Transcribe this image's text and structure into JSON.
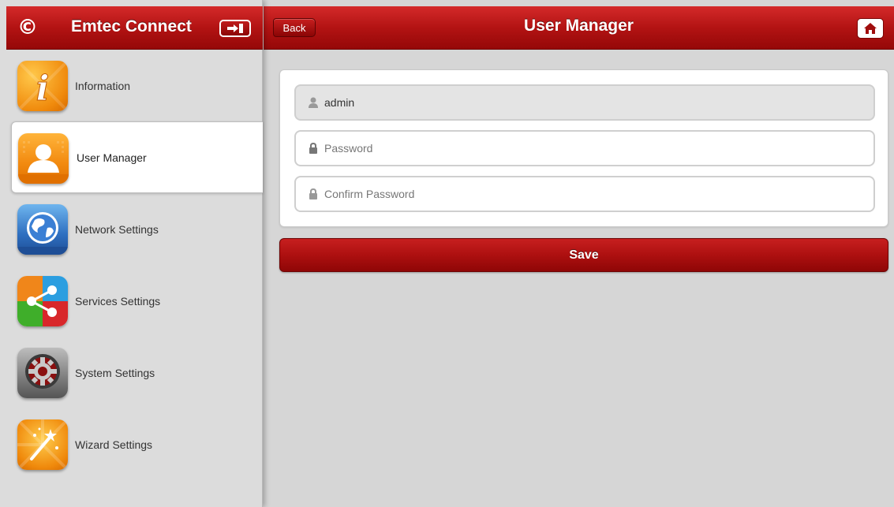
{
  "app": {
    "title": "Emtec Connect",
    "accent_color": "#b31313"
  },
  "header": {
    "back_label": "Back",
    "page_title": "User Manager"
  },
  "sidebar": {
    "items": [
      {
        "label": "Information",
        "icon": "information-icon",
        "active": false
      },
      {
        "label": "User Manager",
        "icon": "user-icon",
        "active": true
      },
      {
        "label": "Network Settings",
        "icon": "globe-icon",
        "active": false
      },
      {
        "label": "Services Settings",
        "icon": "share-icon",
        "active": false
      },
      {
        "label": "System Settings",
        "icon": "gear-icon",
        "active": false
      },
      {
        "label": "Wizard Settings",
        "icon": "magic-wand-icon",
        "active": false
      }
    ]
  },
  "form": {
    "username_value": "admin",
    "password_placeholder": "Password",
    "confirm_placeholder": "Confirm Password",
    "save_label": "Save"
  }
}
